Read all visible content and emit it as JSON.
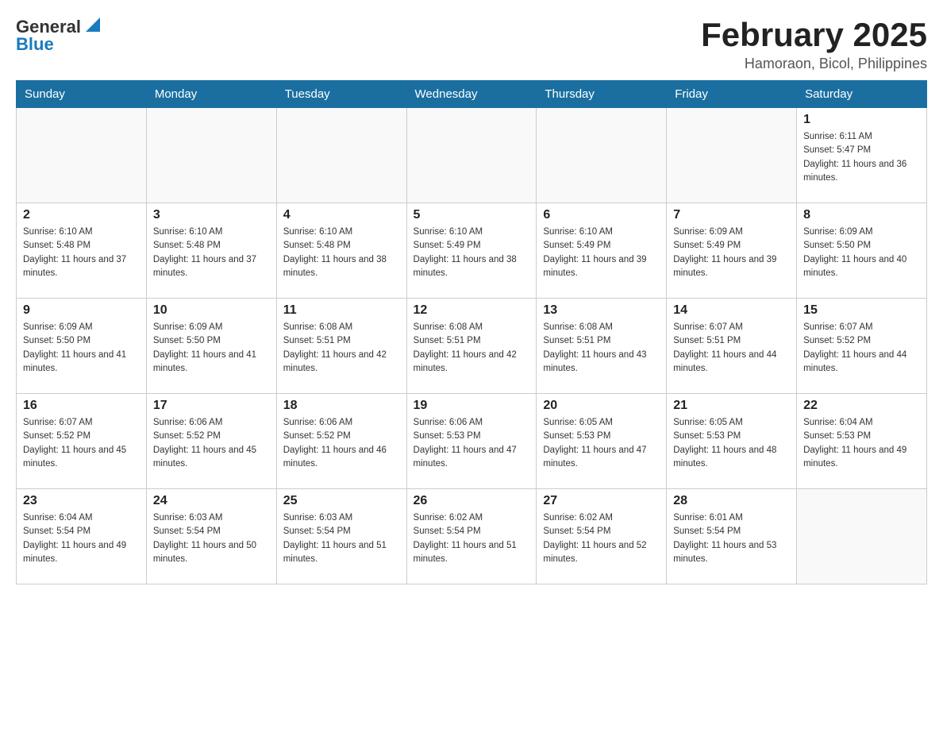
{
  "header": {
    "logo_text_general": "General",
    "logo_text_blue": "Blue",
    "title": "February 2025",
    "subtitle": "Hamoraon, Bicol, Philippines"
  },
  "days_of_week": [
    "Sunday",
    "Monday",
    "Tuesday",
    "Wednesday",
    "Thursday",
    "Friday",
    "Saturday"
  ],
  "weeks": [
    [
      {
        "day": "",
        "info": ""
      },
      {
        "day": "",
        "info": ""
      },
      {
        "day": "",
        "info": ""
      },
      {
        "day": "",
        "info": ""
      },
      {
        "day": "",
        "info": ""
      },
      {
        "day": "",
        "info": ""
      },
      {
        "day": "1",
        "info": "Sunrise: 6:11 AM\nSunset: 5:47 PM\nDaylight: 11 hours and 36 minutes."
      }
    ],
    [
      {
        "day": "2",
        "info": "Sunrise: 6:10 AM\nSunset: 5:48 PM\nDaylight: 11 hours and 37 minutes."
      },
      {
        "day": "3",
        "info": "Sunrise: 6:10 AM\nSunset: 5:48 PM\nDaylight: 11 hours and 37 minutes."
      },
      {
        "day": "4",
        "info": "Sunrise: 6:10 AM\nSunset: 5:48 PM\nDaylight: 11 hours and 38 minutes."
      },
      {
        "day": "5",
        "info": "Sunrise: 6:10 AM\nSunset: 5:49 PM\nDaylight: 11 hours and 38 minutes."
      },
      {
        "day": "6",
        "info": "Sunrise: 6:10 AM\nSunset: 5:49 PM\nDaylight: 11 hours and 39 minutes."
      },
      {
        "day": "7",
        "info": "Sunrise: 6:09 AM\nSunset: 5:49 PM\nDaylight: 11 hours and 39 minutes."
      },
      {
        "day": "8",
        "info": "Sunrise: 6:09 AM\nSunset: 5:50 PM\nDaylight: 11 hours and 40 minutes."
      }
    ],
    [
      {
        "day": "9",
        "info": "Sunrise: 6:09 AM\nSunset: 5:50 PM\nDaylight: 11 hours and 41 minutes."
      },
      {
        "day": "10",
        "info": "Sunrise: 6:09 AM\nSunset: 5:50 PM\nDaylight: 11 hours and 41 minutes."
      },
      {
        "day": "11",
        "info": "Sunrise: 6:08 AM\nSunset: 5:51 PM\nDaylight: 11 hours and 42 minutes."
      },
      {
        "day": "12",
        "info": "Sunrise: 6:08 AM\nSunset: 5:51 PM\nDaylight: 11 hours and 42 minutes."
      },
      {
        "day": "13",
        "info": "Sunrise: 6:08 AM\nSunset: 5:51 PM\nDaylight: 11 hours and 43 minutes."
      },
      {
        "day": "14",
        "info": "Sunrise: 6:07 AM\nSunset: 5:51 PM\nDaylight: 11 hours and 44 minutes."
      },
      {
        "day": "15",
        "info": "Sunrise: 6:07 AM\nSunset: 5:52 PM\nDaylight: 11 hours and 44 minutes."
      }
    ],
    [
      {
        "day": "16",
        "info": "Sunrise: 6:07 AM\nSunset: 5:52 PM\nDaylight: 11 hours and 45 minutes."
      },
      {
        "day": "17",
        "info": "Sunrise: 6:06 AM\nSunset: 5:52 PM\nDaylight: 11 hours and 45 minutes."
      },
      {
        "day": "18",
        "info": "Sunrise: 6:06 AM\nSunset: 5:52 PM\nDaylight: 11 hours and 46 minutes."
      },
      {
        "day": "19",
        "info": "Sunrise: 6:06 AM\nSunset: 5:53 PM\nDaylight: 11 hours and 47 minutes."
      },
      {
        "day": "20",
        "info": "Sunrise: 6:05 AM\nSunset: 5:53 PM\nDaylight: 11 hours and 47 minutes."
      },
      {
        "day": "21",
        "info": "Sunrise: 6:05 AM\nSunset: 5:53 PM\nDaylight: 11 hours and 48 minutes."
      },
      {
        "day": "22",
        "info": "Sunrise: 6:04 AM\nSunset: 5:53 PM\nDaylight: 11 hours and 49 minutes."
      }
    ],
    [
      {
        "day": "23",
        "info": "Sunrise: 6:04 AM\nSunset: 5:54 PM\nDaylight: 11 hours and 49 minutes."
      },
      {
        "day": "24",
        "info": "Sunrise: 6:03 AM\nSunset: 5:54 PM\nDaylight: 11 hours and 50 minutes."
      },
      {
        "day": "25",
        "info": "Sunrise: 6:03 AM\nSunset: 5:54 PM\nDaylight: 11 hours and 51 minutes."
      },
      {
        "day": "26",
        "info": "Sunrise: 6:02 AM\nSunset: 5:54 PM\nDaylight: 11 hours and 51 minutes."
      },
      {
        "day": "27",
        "info": "Sunrise: 6:02 AM\nSunset: 5:54 PM\nDaylight: 11 hours and 52 minutes."
      },
      {
        "day": "28",
        "info": "Sunrise: 6:01 AM\nSunset: 5:54 PM\nDaylight: 11 hours and 53 minutes."
      },
      {
        "day": "",
        "info": ""
      }
    ]
  ]
}
